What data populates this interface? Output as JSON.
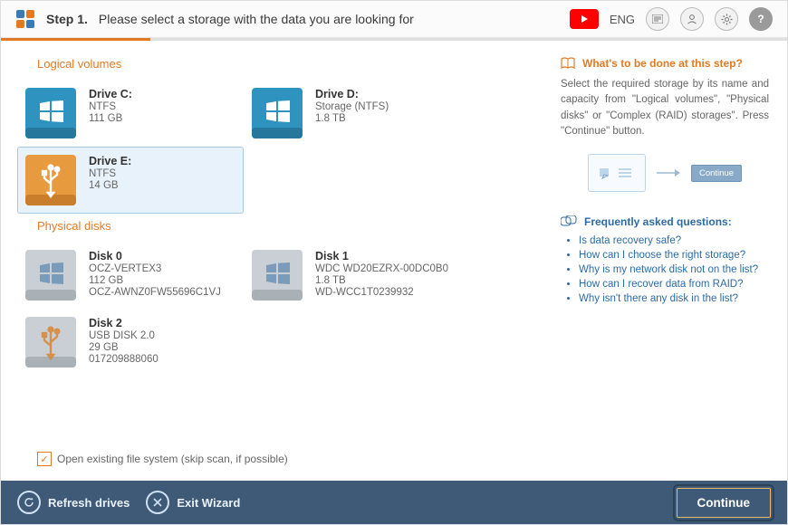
{
  "header": {
    "step_label": "Step 1.",
    "step_text": "Please select a storage with the data you are looking for",
    "language": "ENG"
  },
  "sections": {
    "logical_title": "Logical volumes",
    "physical_title": "Physical disks"
  },
  "logical": [
    {
      "name": "Drive C:",
      "fs": "NTFS",
      "size": "111 GB",
      "variant": "win-blue",
      "selected": false
    },
    {
      "name": "Drive D:",
      "fs": "Storage (NTFS)",
      "size": "1.8 TB",
      "variant": "win-blue",
      "selected": false
    },
    {
      "name": "Drive E:",
      "fs": "NTFS",
      "size": "14 GB",
      "variant": "usb-orange",
      "selected": true
    }
  ],
  "physical": [
    {
      "name": "Disk 0",
      "model": "OCZ-VERTEX3",
      "size": "112 GB",
      "serial": "OCZ-AWNZ0FW55696C1VJ",
      "variant": "win-gray"
    },
    {
      "name": "Disk 1",
      "model": "WDC WD20EZRX-00DC0B0",
      "size": "1.8 TB",
      "serial": "WD-WCC1T0239932",
      "variant": "win-gray"
    },
    {
      "name": "Disk 2",
      "model": "USB DISK 2.0",
      "size": "29 GB",
      "serial": "017209888060",
      "variant": "usb-gray"
    }
  ],
  "checkbox": {
    "label": "Open existing file system (skip scan, if possible)",
    "checked": true
  },
  "help": {
    "title": "What's to be done at this step?",
    "body": "Select the required storage by its name and capacity from \"Logical volumes\", \"Physical disks\" or \"Complex (RAID) storages\". Press \"Continue\" button.",
    "illus_btn": "Continue"
  },
  "faq": {
    "title": "Frequently asked questions:",
    "items": [
      "Is data recovery safe?",
      "How can I choose the right storage?",
      "Why is my network disk not on the list?",
      "How can I recover data from RAID?",
      "Why isn't there any disk in the list?"
    ]
  },
  "footer": {
    "refresh": "Refresh drives",
    "exit": "Exit Wizard",
    "continue": "Continue"
  }
}
